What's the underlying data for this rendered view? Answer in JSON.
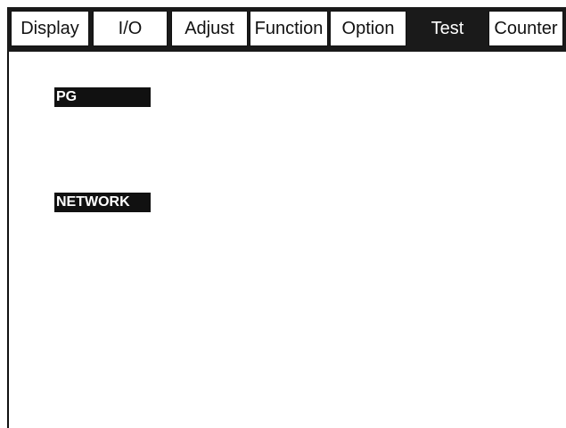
{
  "tabs": [
    {
      "label": "Display",
      "active": false
    },
    {
      "label": "I/O",
      "active": false
    },
    {
      "label": "Adjust",
      "active": false
    },
    {
      "label": "Function",
      "active": false
    },
    {
      "label": "Option",
      "active": false
    },
    {
      "label": "Test",
      "active": true
    },
    {
      "label": "Counter",
      "active": false
    }
  ],
  "items": {
    "pg_label": "PG",
    "network_label": "NETWORK"
  },
  "colors": {
    "active_tab_bg": "#1a1a1a",
    "inactive_tab_bg": "#ffffff",
    "button_bg": "#111111",
    "button_text": "#ffffff"
  }
}
